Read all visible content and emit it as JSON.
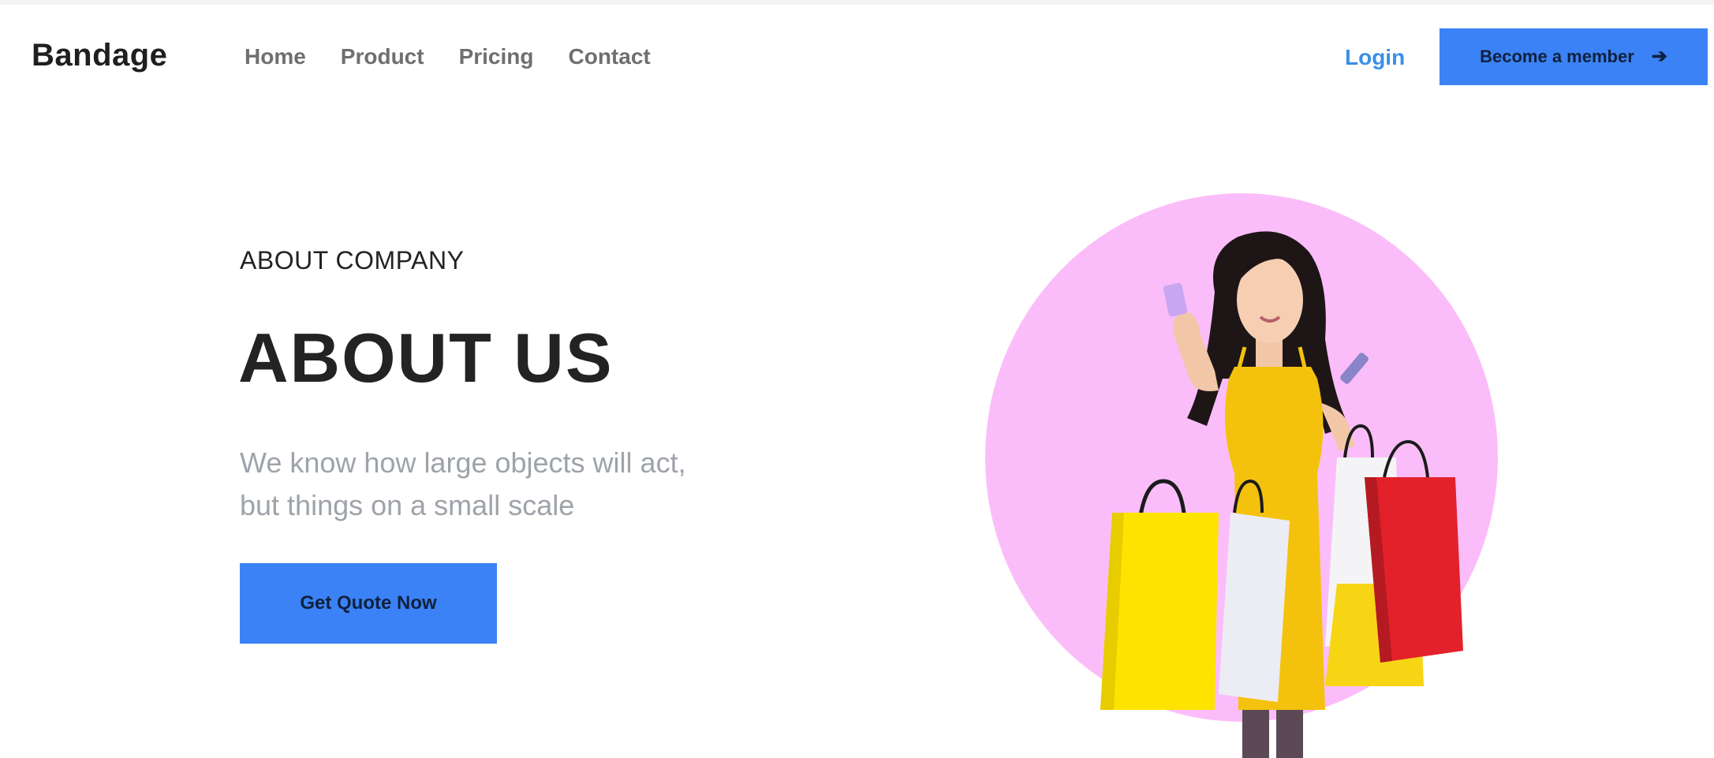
{
  "header": {
    "logo": "Bandage",
    "nav": [
      {
        "label": "Home"
      },
      {
        "label": "Product"
      },
      {
        "label": "Pricing"
      },
      {
        "label": "Contact"
      }
    ],
    "login_label": "Login",
    "member_button_label": "Become a member",
    "member_button_icon": "arrow-right-icon"
  },
  "hero": {
    "eyebrow": "ABOUT COMPANY",
    "title": "ABOUT US",
    "subtitle_line1": "We know how large objects will act,",
    "subtitle_line2": "but things on a small scale",
    "cta_label": "Get Quote Now"
  },
  "colors": {
    "accent": "#3b82f6",
    "login": "#3a8fe6",
    "circle": "#fbbdf9",
    "dress": "#f4c20d",
    "bag_yellow": "#fde300",
    "bag_red": "#e3212b"
  }
}
